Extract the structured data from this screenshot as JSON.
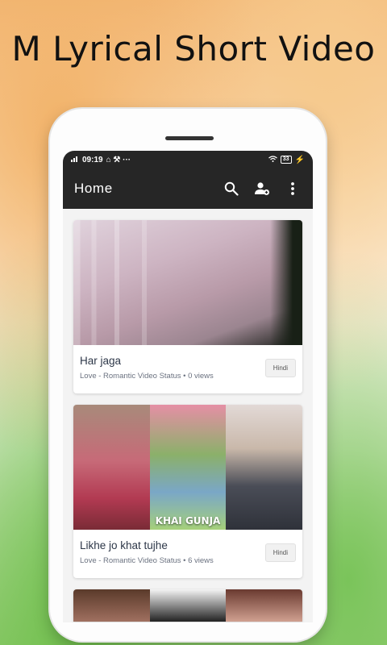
{
  "promo": {
    "headline": "M Lyrical Short Video"
  },
  "status_bar": {
    "time": "09:19",
    "battery": "33"
  },
  "app_bar": {
    "title": "Home",
    "icons": [
      "search-icon",
      "add-user-icon",
      "more-vert-icon"
    ]
  },
  "videos": [
    {
      "title": "Har jaga",
      "meta": "Love - Romantic Video Status • 0 views",
      "language": "Hindi"
    },
    {
      "title": "Likhe jo khat tujhe",
      "meta": "Love - Romantic Video Status • 6 views",
      "language": "Hindi",
      "overlay": "KHAI GUNJA"
    }
  ]
}
